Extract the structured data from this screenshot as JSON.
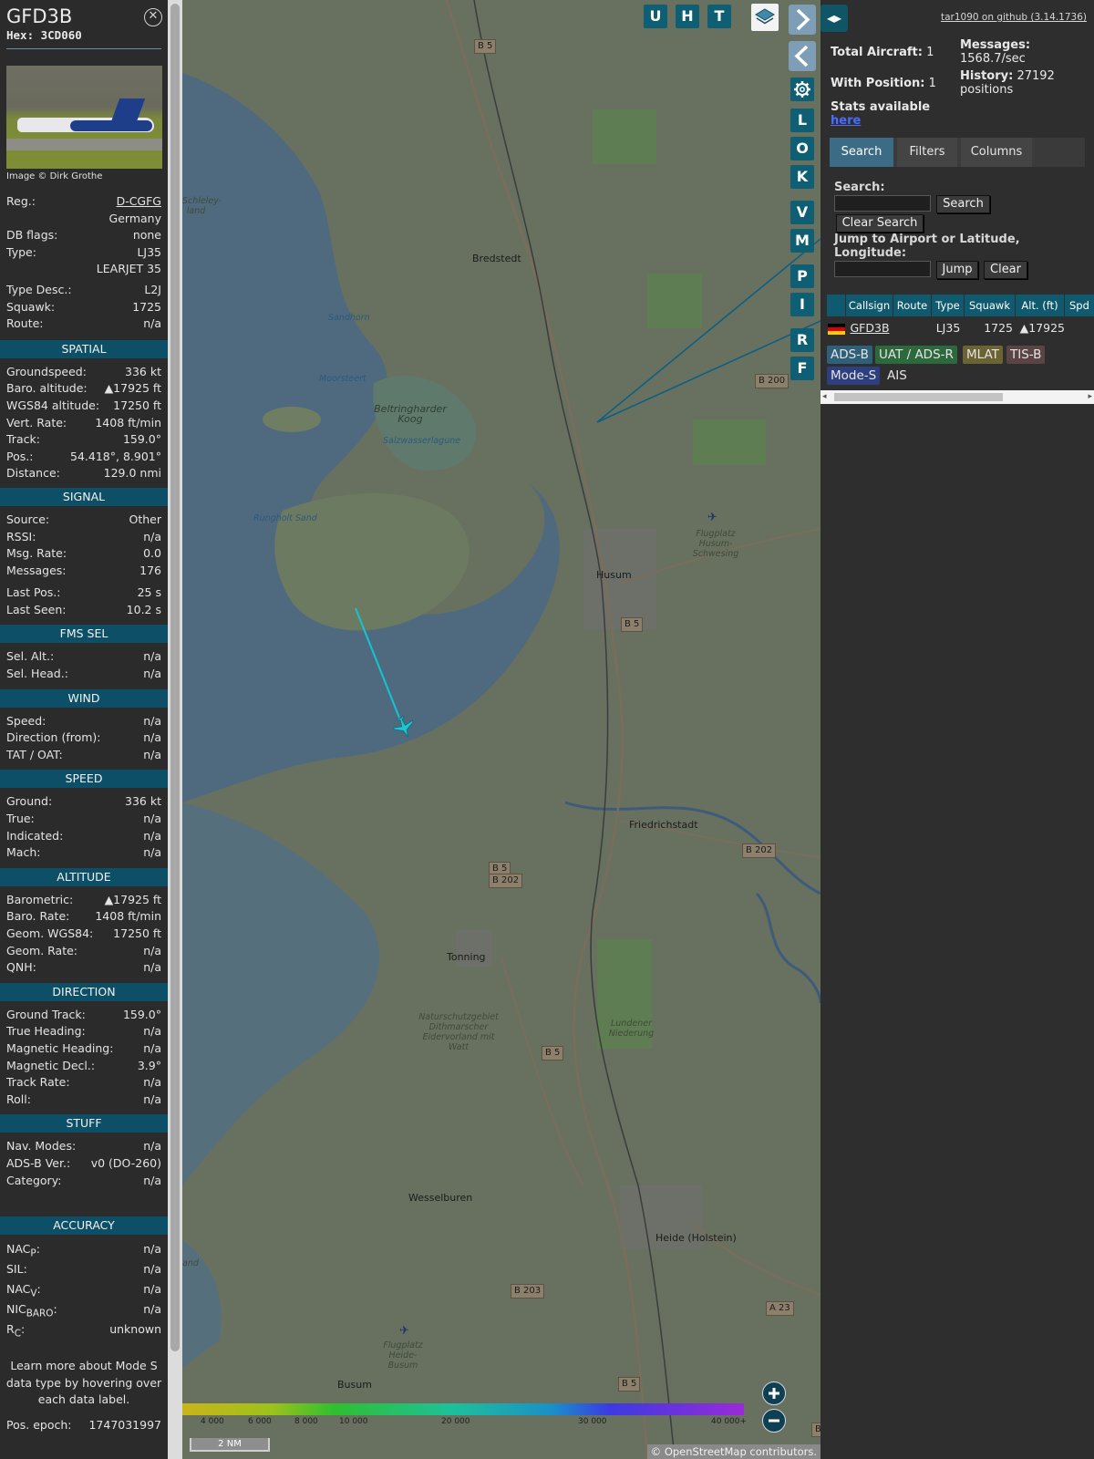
{
  "aircraft": {
    "callsign": "GFD3B",
    "hex_label": "Hex: 3CD060",
    "photo_credit": "Image © Dirk Grothe"
  },
  "details": [
    {
      "label": "Reg.:",
      "value": "D-CGFG"
    },
    {
      "label": "",
      "value": "Germany"
    },
    {
      "label": "DB flags:",
      "value": "none"
    },
    {
      "label": "Type:",
      "value": "LJ35"
    },
    {
      "label": "",
      "value": "LEARJET 35"
    },
    {
      "label": "Type Desc.:",
      "value": "L2J"
    },
    {
      "label": "Squawk:",
      "value": "1725"
    },
    {
      "label": "Route:",
      "value": "n/a"
    }
  ],
  "sections": {
    "spatial": {
      "title": "SPATIAL",
      "rows": [
        {
          "label": "Groundspeed:",
          "value": "336 kt"
        },
        {
          "label": "Baro. altitude:",
          "value": "▲17925 ft"
        },
        {
          "label": "WGS84 altitude:",
          "value": "17250 ft"
        },
        {
          "label": "Vert. Rate:",
          "value": "1408 ft/min"
        },
        {
          "label": "Track:",
          "value": "159.0°"
        },
        {
          "label": "Pos.:",
          "value": "54.418°, 8.901°"
        },
        {
          "label": "Distance:",
          "value": "129.0 nmi"
        }
      ]
    },
    "signal": {
      "title": "SIGNAL",
      "rows": [
        {
          "label": "Source:",
          "value": "Other"
        },
        {
          "label": "RSSI:",
          "value": "n/a"
        },
        {
          "label": "Msg. Rate:",
          "value": "0.0"
        },
        {
          "label": "Messages:",
          "value": "176"
        },
        {
          "label": "Last Pos.:",
          "value": "25 s"
        },
        {
          "label": "Last Seen:",
          "value": "10.2 s"
        }
      ]
    },
    "fms": {
      "title": "FMS SEL",
      "rows": [
        {
          "label": "Sel. Alt.:",
          "value": "n/a"
        },
        {
          "label": "Sel. Head.:",
          "value": "n/a"
        }
      ]
    },
    "wind": {
      "title": "WIND",
      "rows": [
        {
          "label": "Speed:",
          "value": "n/a"
        },
        {
          "label": "Direction (from):",
          "value": "n/a"
        },
        {
          "label": "TAT / OAT:",
          "value": "n/a"
        }
      ]
    },
    "speed": {
      "title": "SPEED",
      "rows": [
        {
          "label": "Ground:",
          "value": "336 kt"
        },
        {
          "label": "True:",
          "value": "n/a"
        },
        {
          "label": "Indicated:",
          "value": "n/a"
        },
        {
          "label": "Mach:",
          "value": "n/a"
        }
      ]
    },
    "altitude": {
      "title": "ALTITUDE",
      "rows": [
        {
          "label": "Barometric:",
          "value": "▲17925 ft"
        },
        {
          "label": "Baro. Rate:",
          "value": "1408 ft/min"
        },
        {
          "label": "Geom. WGS84:",
          "value": "17250 ft"
        },
        {
          "label": "Geom. Rate:",
          "value": "n/a"
        },
        {
          "label": "QNH:",
          "value": "n/a"
        }
      ]
    },
    "direction": {
      "title": "DIRECTION",
      "rows": [
        {
          "label": "Ground Track:",
          "value": "159.0°"
        },
        {
          "label": "True Heading:",
          "value": "n/a"
        },
        {
          "label": "Magnetic Heading:",
          "value": "n/a"
        },
        {
          "label": "Magnetic Decl.:",
          "value": "3.9°"
        },
        {
          "label": "Track Rate:",
          "value": "n/a"
        },
        {
          "label": "Roll:",
          "value": "n/a"
        }
      ]
    },
    "stuff": {
      "title": "STUFF",
      "rows": [
        {
          "label": "Nav. Modes:",
          "value": "n/a"
        },
        {
          "label": "ADS-B Ver.:",
          "value": "v0 (DO-260)"
        },
        {
          "label": "Category:",
          "value": "n/a"
        }
      ]
    },
    "accuracy": {
      "title": "ACCURACY",
      "rows": [
        {
          "label_main": "NAC",
          "label_sub": "P",
          "value": "n/a"
        },
        {
          "label_main": "SIL:",
          "label_sub": "",
          "value": "n/a"
        },
        {
          "label_main": "NAC",
          "label_sub": "V",
          "value": "n/a"
        },
        {
          "label_main": "NIC",
          "label_sub": "BARO",
          "value": "n/a"
        },
        {
          "label_main": "R",
          "label_sub": "C",
          "value": "unknown"
        }
      ]
    }
  },
  "learn_more": "Learn more about Mode S data type by hovering over each data label.",
  "pos_epoch": {
    "label": "Pos. epoch:",
    "value": "1747031997"
  },
  "map": {
    "top_buttons": [
      "U",
      "H",
      "T"
    ],
    "side_buttons": [
      "L",
      "O",
      "K",
      "V",
      "M",
      "P",
      "I",
      "R",
      "F"
    ],
    "settings_icon": "gear-icon",
    "layers_icon": "layers-icon",
    "places": [
      "Bredstedt",
      "Husum",
      "Friedrichstadt",
      "Tonning",
      "Wesselburen",
      "Heide (Holstein)",
      "Busum"
    ],
    "water_labels": [
      "Sandhorn",
      "Moorsteert",
      "Rungholt Sand",
      "Salzwasserlagune"
    ],
    "nature_labels": [
      "Beltringharder Koog",
      "Flugplatz Husum-Schwesing",
      "Naturschutzgebiet Dithmarscher Eidervorland mit Watt",
      "Lundener Niederung",
      "Flugplatz Heide-Busum",
      "Schleley-land",
      "and"
    ],
    "road_badges": [
      "B 5",
      "B 200",
      "B 5",
      "B 202",
      "B 5",
      "B 202",
      "B 5",
      "B 203",
      "A 23",
      "B 5",
      "B"
    ],
    "altitude_scale_ticks": [
      "4 000",
      "6 000",
      "8 000",
      "10 000",
      "20 000",
      "30 000",
      "40 000+"
    ],
    "scale_bar": "2 NM",
    "attribution": "© OpenStreetMap contributors."
  },
  "stats": {
    "total_aircraft_label": "Total Aircraft:",
    "total_aircraft_value": "1",
    "with_position_label": "With Position:",
    "with_position_value": "1",
    "messages_label": "Messages:",
    "messages_value": "1568.7/sec",
    "history_label": "History:",
    "history_value": "27192 positions",
    "stats_text": "Stats available",
    "stats_link": "here",
    "version_link": "tar1090 on github (3.14.1736)"
  },
  "tabs": [
    "Search",
    "Filters",
    "Columns"
  ],
  "search": {
    "search_label": "Search:",
    "search_value": "",
    "search_button": "Search",
    "clear_search_button": "Clear Search",
    "jump_label": "Jump to Airport or Latitude, Longitude:",
    "jump_value": "",
    "jump_button": "Jump",
    "clear_button": "Clear"
  },
  "table": {
    "headers": [
      "",
      "Callsign",
      "Route",
      "Type",
      "Squawk",
      "Alt. (ft)",
      "Spd"
    ],
    "rows": [
      {
        "flag": "de-flag",
        "callsign": "GFD3B",
        "route": "",
        "type": "LJ35",
        "squawk": "1725",
        "alt": "▲17925",
        "spd": ""
      }
    ]
  },
  "source_legend": [
    {
      "label": "ADS-B",
      "color": "#2f6079"
    },
    {
      "label": "UAT / ADS-R",
      "color": "#2c6a3e"
    },
    {
      "label": "MLAT",
      "color": "#6c6332"
    },
    {
      "label": "TIS-B",
      "color": "#5b4444"
    },
    {
      "label": "Mode-S",
      "color": "#2e3f7f"
    },
    {
      "label": "AIS",
      "color": ""
    }
  ],
  "colors": {
    "section_header": "#0d4f66",
    "accent_button": "#0f5f74",
    "track": "#11c6d2"
  }
}
